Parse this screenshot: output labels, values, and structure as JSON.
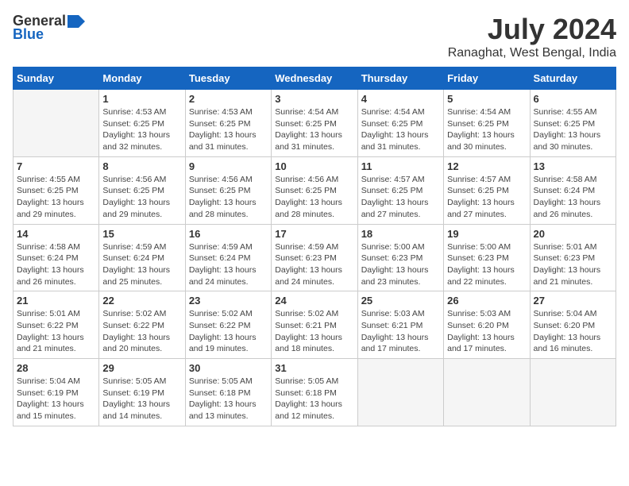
{
  "header": {
    "logo_general": "General",
    "logo_blue": "Blue",
    "month_year": "July 2024",
    "location": "Ranaghat, West Bengal, India"
  },
  "weekdays": [
    "Sunday",
    "Monday",
    "Tuesday",
    "Wednesday",
    "Thursday",
    "Friday",
    "Saturday"
  ],
  "weeks": [
    [
      {
        "day": "",
        "sunrise": "",
        "sunset": "",
        "daylight": ""
      },
      {
        "day": "1",
        "sunrise": "Sunrise: 4:53 AM",
        "sunset": "Sunset: 6:25 PM",
        "daylight": "Daylight: 13 hours and 32 minutes."
      },
      {
        "day": "2",
        "sunrise": "Sunrise: 4:53 AM",
        "sunset": "Sunset: 6:25 PM",
        "daylight": "Daylight: 13 hours and 31 minutes."
      },
      {
        "day": "3",
        "sunrise": "Sunrise: 4:54 AM",
        "sunset": "Sunset: 6:25 PM",
        "daylight": "Daylight: 13 hours and 31 minutes."
      },
      {
        "day": "4",
        "sunrise": "Sunrise: 4:54 AM",
        "sunset": "Sunset: 6:25 PM",
        "daylight": "Daylight: 13 hours and 31 minutes."
      },
      {
        "day": "5",
        "sunrise": "Sunrise: 4:54 AM",
        "sunset": "Sunset: 6:25 PM",
        "daylight": "Daylight: 13 hours and 30 minutes."
      },
      {
        "day": "6",
        "sunrise": "Sunrise: 4:55 AM",
        "sunset": "Sunset: 6:25 PM",
        "daylight": "Daylight: 13 hours and 30 minutes."
      }
    ],
    [
      {
        "day": "7",
        "sunrise": "Sunrise: 4:55 AM",
        "sunset": "Sunset: 6:25 PM",
        "daylight": "Daylight: 13 hours and 29 minutes."
      },
      {
        "day": "8",
        "sunrise": "Sunrise: 4:56 AM",
        "sunset": "Sunset: 6:25 PM",
        "daylight": "Daylight: 13 hours and 29 minutes."
      },
      {
        "day": "9",
        "sunrise": "Sunrise: 4:56 AM",
        "sunset": "Sunset: 6:25 PM",
        "daylight": "Daylight: 13 hours and 28 minutes."
      },
      {
        "day": "10",
        "sunrise": "Sunrise: 4:56 AM",
        "sunset": "Sunset: 6:25 PM",
        "daylight": "Daylight: 13 hours and 28 minutes."
      },
      {
        "day": "11",
        "sunrise": "Sunrise: 4:57 AM",
        "sunset": "Sunset: 6:25 PM",
        "daylight": "Daylight: 13 hours and 27 minutes."
      },
      {
        "day": "12",
        "sunrise": "Sunrise: 4:57 AM",
        "sunset": "Sunset: 6:25 PM",
        "daylight": "Daylight: 13 hours and 27 minutes."
      },
      {
        "day": "13",
        "sunrise": "Sunrise: 4:58 AM",
        "sunset": "Sunset: 6:24 PM",
        "daylight": "Daylight: 13 hours and 26 minutes."
      }
    ],
    [
      {
        "day": "14",
        "sunrise": "Sunrise: 4:58 AM",
        "sunset": "Sunset: 6:24 PM",
        "daylight": "Daylight: 13 hours and 26 minutes."
      },
      {
        "day": "15",
        "sunrise": "Sunrise: 4:59 AM",
        "sunset": "Sunset: 6:24 PM",
        "daylight": "Daylight: 13 hours and 25 minutes."
      },
      {
        "day": "16",
        "sunrise": "Sunrise: 4:59 AM",
        "sunset": "Sunset: 6:24 PM",
        "daylight": "Daylight: 13 hours and 24 minutes."
      },
      {
        "day": "17",
        "sunrise": "Sunrise: 4:59 AM",
        "sunset": "Sunset: 6:23 PM",
        "daylight": "Daylight: 13 hours and 24 minutes."
      },
      {
        "day": "18",
        "sunrise": "Sunrise: 5:00 AM",
        "sunset": "Sunset: 6:23 PM",
        "daylight": "Daylight: 13 hours and 23 minutes."
      },
      {
        "day": "19",
        "sunrise": "Sunrise: 5:00 AM",
        "sunset": "Sunset: 6:23 PM",
        "daylight": "Daylight: 13 hours and 22 minutes."
      },
      {
        "day": "20",
        "sunrise": "Sunrise: 5:01 AM",
        "sunset": "Sunset: 6:23 PM",
        "daylight": "Daylight: 13 hours and 21 minutes."
      }
    ],
    [
      {
        "day": "21",
        "sunrise": "Sunrise: 5:01 AM",
        "sunset": "Sunset: 6:22 PM",
        "daylight": "Daylight: 13 hours and 21 minutes."
      },
      {
        "day": "22",
        "sunrise": "Sunrise: 5:02 AM",
        "sunset": "Sunset: 6:22 PM",
        "daylight": "Daylight: 13 hours and 20 minutes."
      },
      {
        "day": "23",
        "sunrise": "Sunrise: 5:02 AM",
        "sunset": "Sunset: 6:22 PM",
        "daylight": "Daylight: 13 hours and 19 minutes."
      },
      {
        "day": "24",
        "sunrise": "Sunrise: 5:02 AM",
        "sunset": "Sunset: 6:21 PM",
        "daylight": "Daylight: 13 hours and 18 minutes."
      },
      {
        "day": "25",
        "sunrise": "Sunrise: 5:03 AM",
        "sunset": "Sunset: 6:21 PM",
        "daylight": "Daylight: 13 hours and 17 minutes."
      },
      {
        "day": "26",
        "sunrise": "Sunrise: 5:03 AM",
        "sunset": "Sunset: 6:20 PM",
        "daylight": "Daylight: 13 hours and 17 minutes."
      },
      {
        "day": "27",
        "sunrise": "Sunrise: 5:04 AM",
        "sunset": "Sunset: 6:20 PM",
        "daylight": "Daylight: 13 hours and 16 minutes."
      }
    ],
    [
      {
        "day": "28",
        "sunrise": "Sunrise: 5:04 AM",
        "sunset": "Sunset: 6:19 PM",
        "daylight": "Daylight: 13 hours and 15 minutes."
      },
      {
        "day": "29",
        "sunrise": "Sunrise: 5:05 AM",
        "sunset": "Sunset: 6:19 PM",
        "daylight": "Daylight: 13 hours and 14 minutes."
      },
      {
        "day": "30",
        "sunrise": "Sunrise: 5:05 AM",
        "sunset": "Sunset: 6:18 PM",
        "daylight": "Daylight: 13 hours and 13 minutes."
      },
      {
        "day": "31",
        "sunrise": "Sunrise: 5:05 AM",
        "sunset": "Sunset: 6:18 PM",
        "daylight": "Daylight: 13 hours and 12 minutes."
      },
      {
        "day": "",
        "sunrise": "",
        "sunset": "",
        "daylight": ""
      },
      {
        "day": "",
        "sunrise": "",
        "sunset": "",
        "daylight": ""
      },
      {
        "day": "",
        "sunrise": "",
        "sunset": "",
        "daylight": ""
      }
    ]
  ]
}
